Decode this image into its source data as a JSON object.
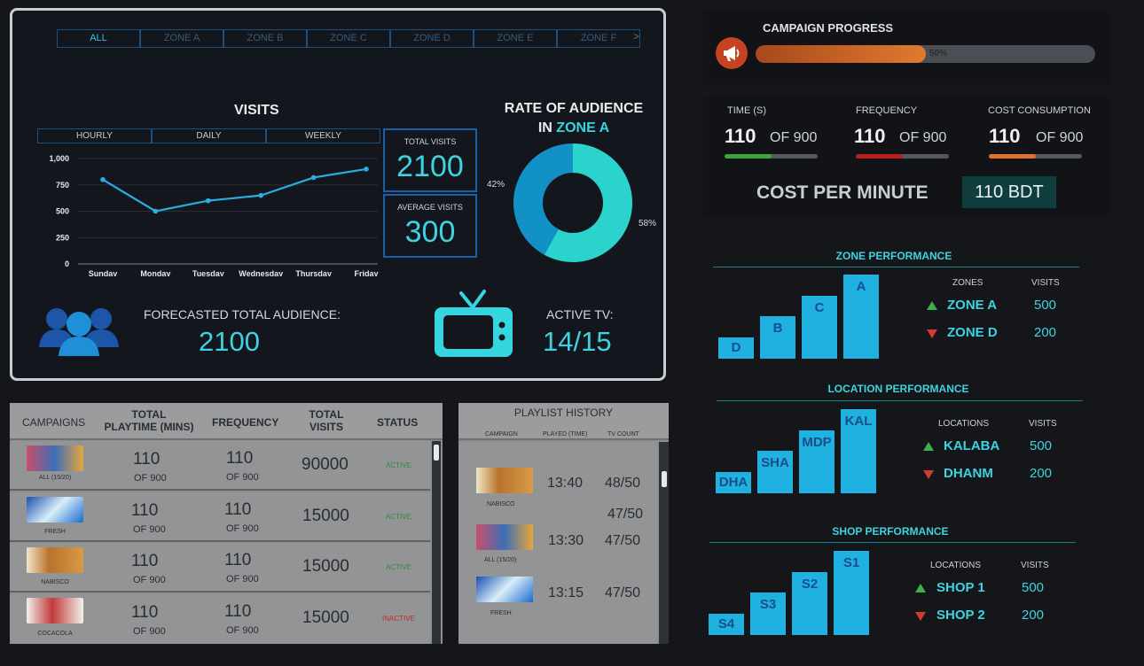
{
  "zone_tabs": [
    "ALL",
    "ZONE A",
    "ZONE B",
    "ZONE C",
    "ZONE D",
    "ZONE E",
    "ZONE F"
  ],
  "zone_tabs_next": ">",
  "visits": {
    "title": "VISITS",
    "periods": [
      "HOURLY",
      "DAILY",
      "WEEKLY"
    ]
  },
  "chart_data": {
    "type": "line",
    "title": "VISITS",
    "categories": [
      "Sunday",
      "Monday",
      "Tuesday",
      "Wednesday",
      "Thursday",
      "Friday"
    ],
    "values": [
      800,
      500,
      600,
      650,
      820,
      900
    ],
    "yticks": [
      "1,000",
      "750",
      "500",
      "250",
      "0"
    ],
    "ylim": [
      0,
      1000
    ],
    "grid": true,
    "color": "#2aaee0"
  },
  "kpis": {
    "total_visits_label": "TOTAL VISITS",
    "total_visits_value": "2100",
    "average_visits_label": "AVERAGE VISITS",
    "average_visits_value": "300"
  },
  "audience_rate": {
    "title_line1": "RATE OF AUDIENCE",
    "title_line2_prefix": "IN",
    "title_zone": "ZONE A",
    "pct_left": "42%",
    "pct_right": "58%",
    "share_a": 58,
    "share_b": 42,
    "color_a": "#2ad3cc",
    "color_b": "#1291c6"
  },
  "forecast": {
    "label": "FORECASTED TOTAL AUDIENCE:",
    "value": "2100"
  },
  "active_tv": {
    "label": "ACTIVE TV:",
    "value": "14/15"
  },
  "campaigns_table": {
    "headers": {
      "campaigns": "CAMPAIGNS",
      "playtime_1": "TOTAL",
      "playtime_2": "PLAYTIME (MINS)",
      "frequency": "FREQUENCY",
      "visits_1": "TOTAL",
      "visits_2": "VISITS",
      "status": "STATUS"
    },
    "rows": [
      {
        "name": "ALL (15/20)",
        "playtime": "110",
        "playtime_of": "OF 900",
        "frequency": "110",
        "frequency_of": "OF 900",
        "visits": "90000",
        "status": "ACTIVE"
      },
      {
        "name": "FRESH",
        "playtime": "110",
        "playtime_of": "OF 900",
        "frequency": "110",
        "frequency_of": "OF 900",
        "visits": "15000",
        "status": "ACTIVE"
      },
      {
        "name": "NABISCO",
        "playtime": "110",
        "playtime_of": "OF 900",
        "frequency": "110",
        "frequency_of": "OF 900",
        "visits": "15000",
        "status": "ACTIVE"
      },
      {
        "name": "COCACOLA",
        "playtime": "110",
        "playtime_of": "OF 900",
        "frequency": "110",
        "frequency_of": "OF 900",
        "visits": "15000",
        "status": "INACTIVE"
      }
    ]
  },
  "playlist": {
    "title": "PLAYLIST HISTORY",
    "col_campaign": "CAMPAIGN",
    "col_played": "PLAYED (TIME)",
    "col_tv": "TV COUNT",
    "rows": [
      {
        "name": "NABISCO",
        "time": "13:40",
        "count": "48/50"
      },
      {
        "name": "",
        "time": "",
        "count": "47/50"
      },
      {
        "name": "ALL (15/20)",
        "time": "13:30",
        "count": "47/50"
      },
      {
        "name": "FRESH",
        "time": "13:15",
        "count": "47/50"
      }
    ]
  },
  "campaign_progress": {
    "title": "CAMPAIGN PROGRESS",
    "percent_label": "50%",
    "progress": 0.5
  },
  "metrics": [
    {
      "label": "TIME (S)",
      "value": "110",
      "of": "OF 900",
      "fill": 0.5,
      "color": "#3aa63a"
    },
    {
      "label": "FREQUENCY",
      "value": "110",
      "of": "OF 900",
      "fill": 0.5,
      "color": "#b81e1e"
    },
    {
      "label": "COST CONSUMPTION",
      "value": "110",
      "of": "OF 900",
      "fill": 0.5,
      "color": "#e0702a"
    }
  ],
  "cost_per_minute": {
    "label": "COST PER MINUTE",
    "value": "110 BDT"
  },
  "zone_performance": {
    "title": "ZONE PERFORMANCE",
    "bars": [
      {
        "label": "D",
        "value": 0.25
      },
      {
        "label": "B",
        "value": 0.5
      },
      {
        "label": "C",
        "value": 0.75
      },
      {
        "label": "A",
        "value": 1.0
      }
    ],
    "col_name": "ZONES",
    "col_visits": "VISITS",
    "rows": [
      {
        "name": "ZONE A",
        "visits": "500",
        "trend": "up"
      },
      {
        "name": "ZONE D",
        "visits": "200",
        "trend": "down"
      }
    ]
  },
  "location_performance": {
    "title": "LOCATION PERFORMANCE",
    "bars": [
      {
        "label": "DHA",
        "value": 0.25
      },
      {
        "label": "SHA",
        "value": 0.5
      },
      {
        "label": "MDP",
        "value": 0.75
      },
      {
        "label": "KAL",
        "value": 1.0
      }
    ],
    "col_name": "LOCATIONS",
    "col_visits": "VISITS",
    "rows": [
      {
        "name": "KALABA",
        "visits": "500",
        "trend": "up"
      },
      {
        "name": "DHANM",
        "visits": "200",
        "trend": "down"
      }
    ]
  },
  "shop_performance": {
    "title": "SHOP PERFORMANCE",
    "bars": [
      {
        "label": "S4",
        "value": 0.25
      },
      {
        "label": "S3",
        "value": 0.5
      },
      {
        "label": "S2",
        "value": 0.75
      },
      {
        "label": "S1",
        "value": 1.0
      }
    ],
    "col_name": "LOCATIONS",
    "col_visits": "VISITS",
    "rows": [
      {
        "name": "SHOP 1",
        "visits": "500",
        "trend": "up"
      },
      {
        "name": "SHOP 2",
        "visits": "200",
        "trend": "down"
      }
    ]
  }
}
